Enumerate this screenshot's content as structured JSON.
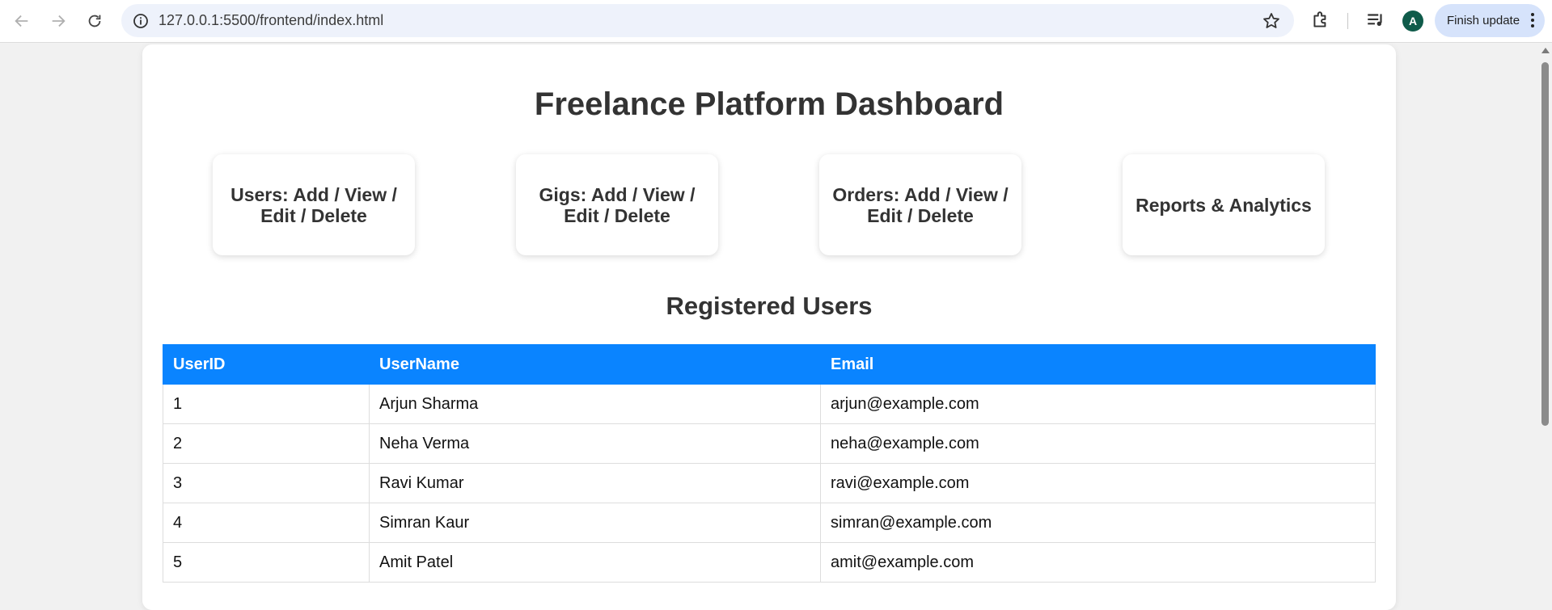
{
  "browser": {
    "url": "127.0.0.1:5500/frontend/index.html",
    "profile_initial": "A",
    "update_label": "Finish update"
  },
  "page": {
    "title": "Freelance Platform Dashboard",
    "tiles": [
      "Users: Add / View / Edit / Delete",
      "Gigs: Add / View / Edit / Delete",
      "Orders: Add / View / Edit / Delete",
      "Reports & Analytics"
    ],
    "section_title": "Registered Users",
    "table": {
      "headers": [
        "UserID",
        "UserName",
        "Email"
      ],
      "rows": [
        [
          "1",
          "Arjun Sharma",
          "arjun@example.com"
        ],
        [
          "2",
          "Neha Verma",
          "neha@example.com"
        ],
        [
          "3",
          "Ravi Kumar",
          "ravi@example.com"
        ],
        [
          "4",
          "Simran Kaur",
          "simran@example.com"
        ],
        [
          "5",
          "Amit Patel",
          "amit@example.com"
        ]
      ]
    }
  },
  "colors": {
    "header_blue": "#0a84ff",
    "avatar_green": "#0f5b4a",
    "update_chip": "#d6e3fb"
  }
}
